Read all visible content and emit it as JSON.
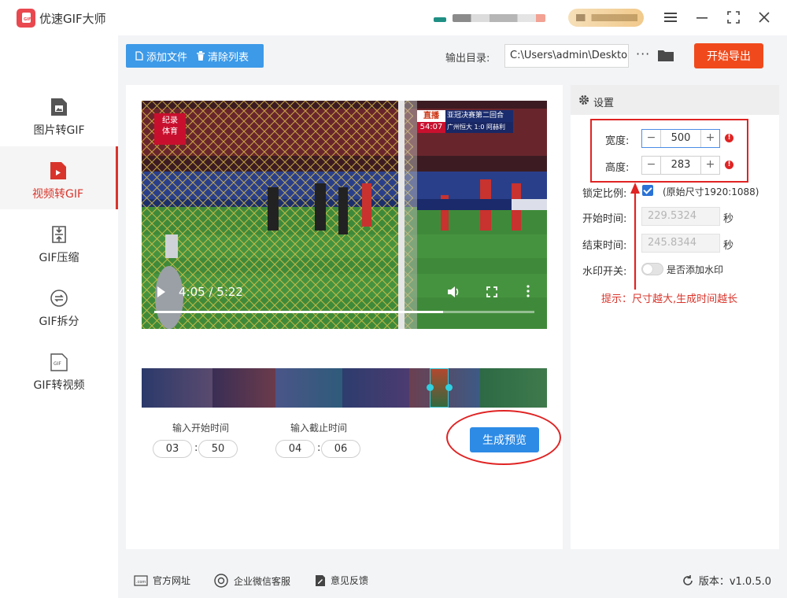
{
  "app": {
    "title": "优速GIF大师",
    "logo_text": "GIF"
  },
  "window_controls": [
    "menu-icon",
    "minimize-icon",
    "maximize-icon",
    "close-icon"
  ],
  "sidebar": {
    "items": [
      {
        "label": "图片转GIF",
        "icon": "image-file-icon",
        "active": false
      },
      {
        "label": "视频转GIF",
        "icon": "video-file-icon",
        "active": true
      },
      {
        "label": "GIF压缩",
        "icon": "compress-icon",
        "active": false
      },
      {
        "label": "GIF拆分",
        "icon": "split-icon",
        "active": false
      },
      {
        "label": "GIF转视频",
        "icon": "gif-file-icon",
        "active": false
      }
    ]
  },
  "toolbar": {
    "add_file": "添加文件",
    "clear_list": "清除列表",
    "output_label": "输出目录:",
    "output_path": "C:\\Users\\admin\\Desktop",
    "more": "···",
    "export": "开始导出"
  },
  "video": {
    "time": "4:05 / 5:22",
    "progress": 0.76,
    "channel_logo": [
      "纪录",
      "体育"
    ],
    "live_tag": "直播",
    "live_title": "亚冠决赛第二回合",
    "live_clock": "54:07",
    "live_score": "广州恒大 1:0 阿赫利"
  },
  "trim": {
    "start_label": "输入开始时间",
    "end_label": "输入截止时间",
    "start_min": "03",
    "start_sec": "50",
    "end_min": "04",
    "end_sec": "06",
    "colon": ":",
    "preview_button": "生成预览"
  },
  "settings": {
    "header": "设置",
    "width_label": "宽度:",
    "width_value": "500",
    "height_label": "高度:",
    "height_value": "283",
    "minus": "−",
    "plus": "+",
    "warn": "!",
    "lock_label": "锁定比例:",
    "lock_checked": true,
    "original_size": "(原始尺寸1920:1088)",
    "start_label": "开始时间:",
    "start_value": "229.5324",
    "end_label": "结束时间:",
    "end_value": "245.8344",
    "unit": "秒",
    "watermark_label": "水印开关:",
    "watermark_toggle_label": "是否添加水印",
    "watermark_on": false,
    "tip": "提示：尺寸越大,生成时间越长"
  },
  "footer": {
    "website": "官方网址",
    "wechat": "企业微信客服",
    "feedback": "意见反馈",
    "version": "版本：v1.0.5.0"
  },
  "colors": {
    "accent_red": "#d9342b",
    "export_orange": "#f04a1c",
    "primary_blue": "#3d9ae8",
    "annotation_red": "#e02323"
  }
}
